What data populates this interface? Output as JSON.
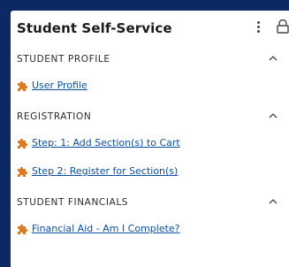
{
  "card": {
    "title": "Student Self-Service"
  },
  "sections": [
    {
      "label": "STUDENT PROFILE",
      "links": [
        "User Profile"
      ]
    },
    {
      "label": "REGISTRATION",
      "links": [
        "Step: 1: Add Section(s) to Cart",
        "Step 2: Register for Section(s)"
      ]
    },
    {
      "label": "STUDENT FINANCIALS",
      "links": [
        "Financial Aid - Am I Complete?"
      ]
    }
  ],
  "icons": {
    "more": "kebab-menu-icon",
    "lock": "lock-icon",
    "collapse": "chevron-up-icon",
    "link": "puzzle-piece-icon"
  },
  "colors": {
    "page_background": "#0b2a63",
    "card_background": "#ffffff",
    "link": "#0b4fa3",
    "link_icon": "#d97a2b"
  }
}
